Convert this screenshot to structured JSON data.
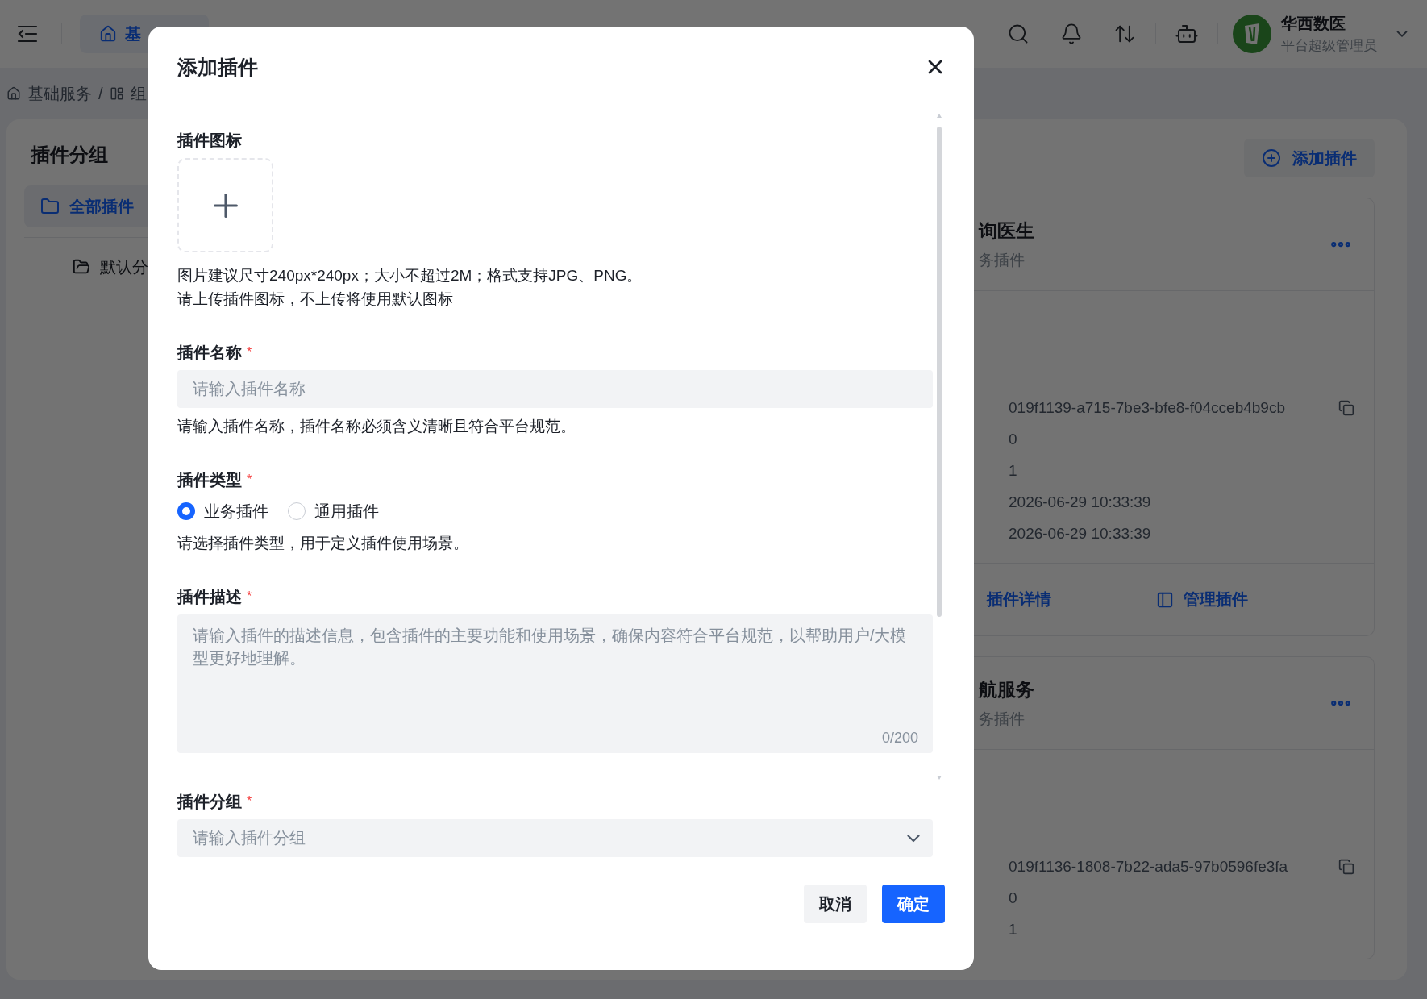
{
  "topbar": {
    "tab_label": "基",
    "user_name": "华西数医",
    "user_role": "平台超级管理员"
  },
  "breadcrumb": {
    "items": [
      "基础服务",
      "组"
    ],
    "separator": "/"
  },
  "sidebar": {
    "title": "插件分组",
    "items": [
      {
        "label": "全部插件",
        "selected": true
      },
      {
        "label": "默认分",
        "selected": false
      }
    ]
  },
  "main": {
    "add_button": "添加插件",
    "cards": [
      {
        "title": "询医生",
        "subtitle": "务插件",
        "fields": [
          "019f1139-a715-7be3-bfe8-f04cceb4b9cb",
          "0",
          "1",
          "2026-06-29 10:33:39",
          "2026-06-29 10:33:39"
        ],
        "actions": [
          "插件详情",
          "管理插件"
        ]
      },
      {
        "title": "航服务",
        "subtitle": "务插件",
        "fields": [
          "019f1136-1808-7b22-ada5-97b0596fe3fa",
          "0",
          "1"
        ]
      }
    ]
  },
  "dialog": {
    "title": "添加插件",
    "fields": [
      {
        "kind": "upload",
        "label": "插件图标",
        "hints": [
          "图片建议尺寸240px*240px；大小不超过2M；格式支持JPG、PNG。",
          "请上传插件图标，不上传将使用默认图标"
        ]
      },
      {
        "kind": "text",
        "label": "插件名称",
        "required_mark": "*",
        "placeholder": "请输入插件名称",
        "hints": [
          "请输入插件名称，插件名称必须含义清晰且符合平台规范。"
        ]
      },
      {
        "kind": "radio",
        "label": "插件类型",
        "required_mark": "*",
        "options": [
          {
            "label": "业务插件",
            "selected": true
          },
          {
            "label": "通用插件",
            "selected": false
          }
        ],
        "hints": [
          "请选择插件类型，用于定义插件使用场景。"
        ]
      },
      {
        "kind": "textarea",
        "label": "插件描述",
        "required_mark": "*",
        "placeholder": "请输入插件的描述信息，包含插件的主要功能和使用场景，确保内容符合平台规范，以帮助用户/大模型更好地理解。",
        "counter": "0/200"
      },
      {
        "kind": "select",
        "label": "插件分组",
        "required_mark": "*",
        "placeholder": "请输入插件分组"
      }
    ],
    "cancel_button": "取消",
    "ok_button": "确定"
  }
}
